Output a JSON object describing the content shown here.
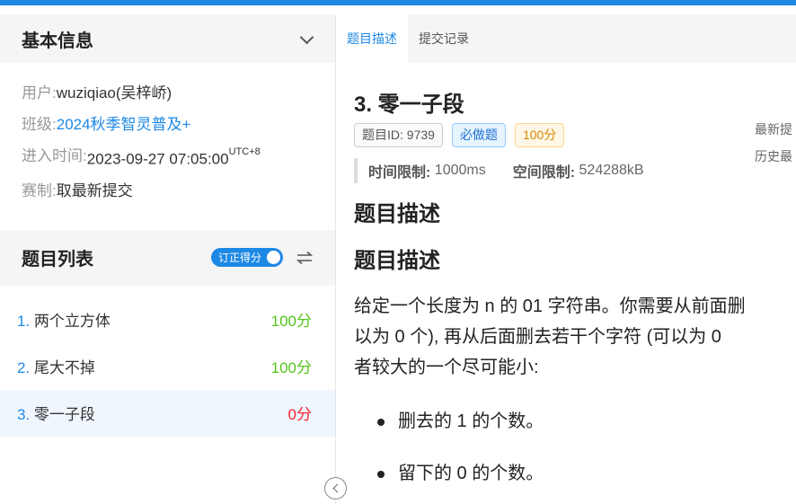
{
  "basic_info": {
    "title": "基本信息",
    "user_key": "用户:",
    "user_val": "wuziqiao(吴梓峤)",
    "class_key": "班级:",
    "class_val": "2024秋季智灵普及+",
    "enter_key": "进入时间:",
    "enter_val": "2023-09-27 07:05:00",
    "enter_tz": "UTC+8",
    "rule_key": "赛制:",
    "rule_val": "取最新提交"
  },
  "problem_list": {
    "title": "题目列表",
    "toggle_label": "订正得分",
    "items": [
      {
        "num": "1.",
        "name": "两个立方体",
        "score": "100分"
      },
      {
        "num": "2.",
        "name": "尾大不掉",
        "score": "100分"
      },
      {
        "num": "3.",
        "name": "零一子段",
        "score": "0分"
      }
    ]
  },
  "tabs": [
    {
      "label": "题目描述"
    },
    {
      "label": "提交记录"
    }
  ],
  "problem": {
    "title": "3. 零一子段",
    "side_note_1": "最新提",
    "side_note_2": "历史最",
    "tag_id": "题目ID: 9739",
    "tag_required": "必做题",
    "tag_score": "100分",
    "time_label": "时间限制:",
    "time_val": "1000ms",
    "mem_label": "空间限制:",
    "mem_val": "524288kB",
    "heading_1": "题目描述",
    "heading_2": "题目描述",
    "para_line_1": "给定一个长度为 n 的 01 字符串。你需要从前面删",
    "para_line_2": "以为 0 个), 再从后面删去若干个字符 (可以为 0",
    "para_line_3": "者较大的一个尽可能小:",
    "bullet_1": "删去的 1 的个数。",
    "bullet_2": "留下的 0 的个数。"
  },
  "colors": {
    "accent": "#1e88e5",
    "score_full": "#52c41a",
    "score_zero": "#f5222d"
  }
}
